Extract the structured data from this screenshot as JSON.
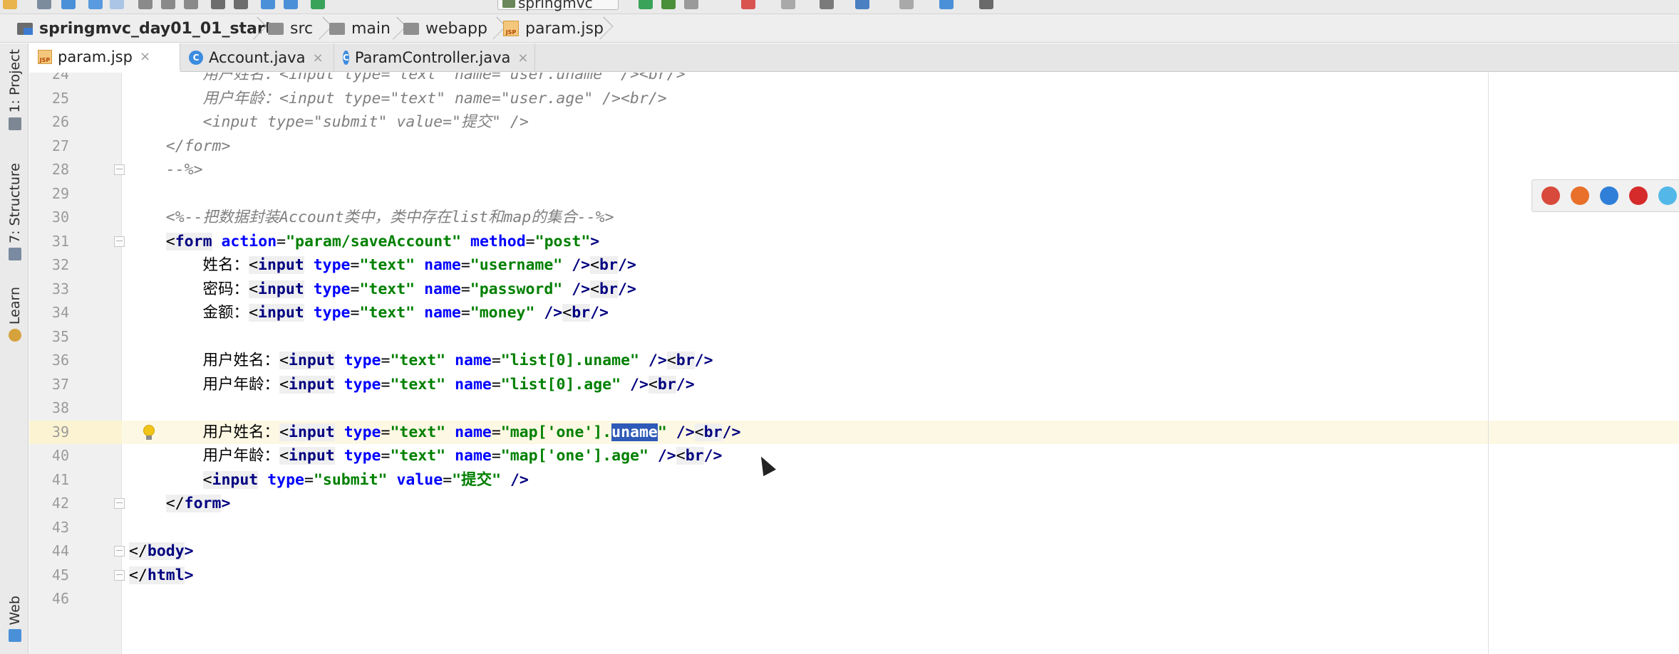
{
  "toolbar": {
    "run_config_label": "springmvc"
  },
  "navbar": {
    "crumbs": [
      {
        "label": "springmvc_day01_01_start",
        "icon": "project-folder-icon"
      },
      {
        "label": "src",
        "icon": "folder-icon"
      },
      {
        "label": "main",
        "icon": "folder-icon"
      },
      {
        "label": "webapp",
        "icon": "folder-icon"
      },
      {
        "label": "param.jsp",
        "icon": "jsp-file-icon"
      }
    ]
  },
  "leftbar": {
    "project_label": "1: Project",
    "structure_label": "7: Structure",
    "learn_label": "Learn",
    "web_label": "Web"
  },
  "tabs": [
    {
      "label": "param.jsp",
      "icon": "jsp-file-icon",
      "active": true
    },
    {
      "label": "Account.java",
      "icon": "java-class-icon",
      "active": false
    },
    {
      "label": "ParamController.java",
      "icon": "java-class-icon",
      "active": false
    }
  ],
  "editor": {
    "caret_line": 39,
    "lines": [
      {
        "n": "24",
        "text": "        用户姓名：<input type=\"text\" name=\"user.uname\" /><br/>"
      },
      {
        "n": "25",
        "text": "        用户年龄：<input type=\"text\" name=\"user.age\" /><br/>"
      },
      {
        "n": "26",
        "text": "        <input type=\"submit\" value=\"提交\" />"
      },
      {
        "n": "27",
        "text": "    </form>"
      },
      {
        "n": "28",
        "text": "    --%>"
      },
      {
        "n": "29",
        "text": ""
      },
      {
        "n": "30",
        "text": "    <%--把数据封装Account类中，类中存在list和map的集合--%>"
      },
      {
        "n": "31",
        "text": "    <form action=\"param/saveAccount\" method=\"post\">"
      },
      {
        "n": "32",
        "text": "        姓名：<input type=\"text\" name=\"username\" /><br/>"
      },
      {
        "n": "33",
        "text": "        密码：<input type=\"text\" name=\"password\" /><br/>"
      },
      {
        "n": "34",
        "text": "        金额：<input type=\"text\" name=\"money\" /><br/>"
      },
      {
        "n": "35",
        "text": ""
      },
      {
        "n": "36",
        "text": "        用户姓名：<input type=\"text\" name=\"list[0].uname\" /><br/>"
      },
      {
        "n": "37",
        "text": "        用户年龄：<input type=\"text\" name=\"list[0].age\" /><br/>"
      },
      {
        "n": "38",
        "text": ""
      },
      {
        "n": "39",
        "text": "        用户姓名：<input type=\"text\" name=\"map['one'].uname\" /><br/>"
      },
      {
        "n": "40",
        "text": "        用户年龄：<input type=\"text\" name=\"map['one'].age\" /><br/>"
      },
      {
        "n": "41",
        "text": "        <input type=\"submit\" value=\"提交\" />"
      },
      {
        "n": "42",
        "text": "    </form>"
      },
      {
        "n": "43",
        "text": ""
      },
      {
        "n": "44",
        "text": "</body>"
      },
      {
        "n": "45",
        "text": "</html>"
      },
      {
        "n": "46",
        "text": ""
      }
    ],
    "selection": {
      "line": 39,
      "text": "uname"
    }
  },
  "browser_popup": {
    "icons": [
      "chrome-icon",
      "firefox-icon",
      "safari-icon",
      "opera-icon",
      "ie-icon"
    ],
    "colors": [
      "#d84b3c",
      "#e8702a",
      "#2f7fd8",
      "#d62b2b",
      "#53b8e8"
    ]
  },
  "colors": {
    "keyword_tag": "#000080",
    "attribute": "#0000ff",
    "string": "#008000",
    "comment": "#808080",
    "selection": "#2e5ab8",
    "caret_row": "#fdf8e3"
  }
}
